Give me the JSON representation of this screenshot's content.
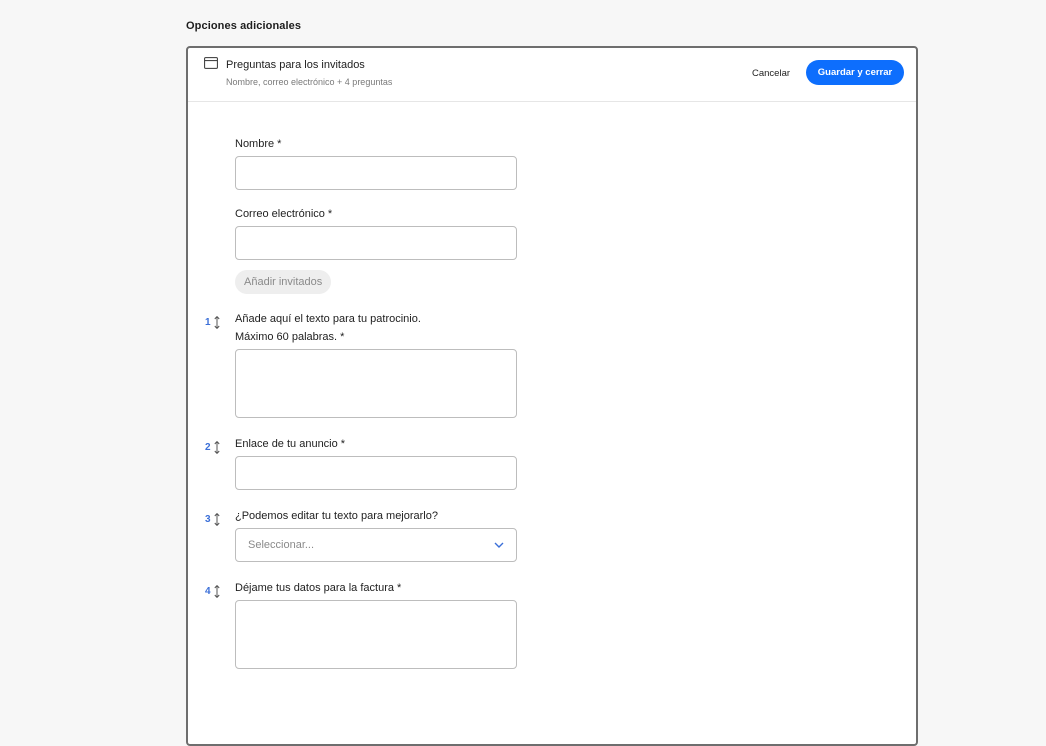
{
  "section": {
    "title": "Opciones adicionales"
  },
  "panel": {
    "header": {
      "title": "Preguntas para los invitados",
      "subtitle": "Nombre, correo electrónico + 4 preguntas",
      "icon": "form-card-icon",
      "cancel_label": "Cancelar",
      "save_label": "Guardar y cerrar"
    },
    "fields": {
      "name_label": "Nombre *",
      "email_label": "Correo electrónico *",
      "add_guests_label": "Añadir invitados"
    },
    "questions": [
      {
        "number": "1",
        "label_line1": "Añade aquí el texto para tu patrocinio.",
        "label_line2": "Máximo 60 palabras. *",
        "type": "textarea"
      },
      {
        "number": "2",
        "label": "Enlace de tu anuncio *",
        "type": "input"
      },
      {
        "number": "3",
        "label": "¿Podemos editar tu texto para mejorarlo?",
        "type": "select",
        "placeholder": "Seleccionar..."
      },
      {
        "number": "4",
        "label": "Déjame tus datos para la factura *",
        "type": "textarea"
      }
    ]
  },
  "colors": {
    "accent": "#0d6efd",
    "handle": "#3b6fd8",
    "border": "#bdbdbd",
    "panel_border": "#6e6e6e"
  }
}
